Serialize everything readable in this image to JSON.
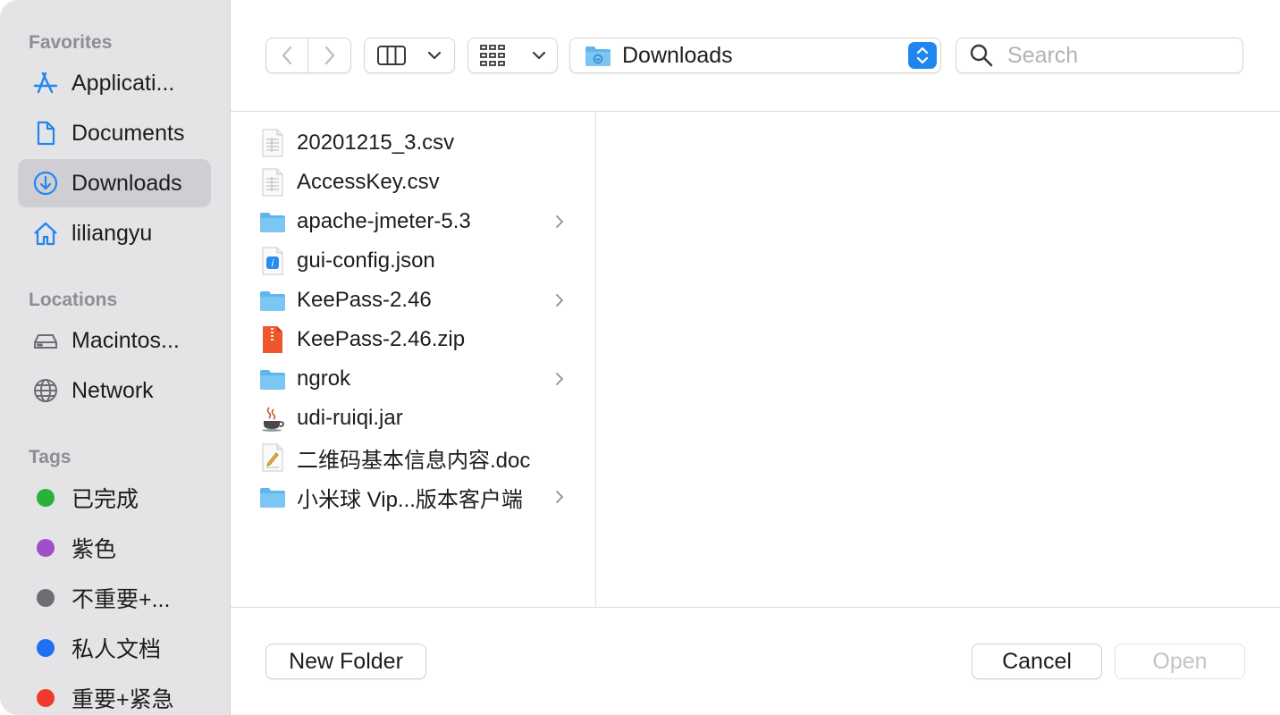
{
  "colors": {
    "accent": "#1f86f0",
    "folder": "#5fb6ef",
    "sidebar_bg": "#e4e4e6"
  },
  "sidebar": {
    "favorites_header": "Favorites",
    "favorites": [
      {
        "label": "Applicati...",
        "icon": "app-store-icon"
      },
      {
        "label": "Documents",
        "icon": "document-icon"
      },
      {
        "label": "Downloads",
        "icon": "download-circle-icon",
        "selected": true
      },
      {
        "label": "liliangyu",
        "icon": "home-icon"
      }
    ],
    "locations_header": "Locations",
    "locations": [
      {
        "label": "Macintos...",
        "icon": "hard-drive-icon"
      },
      {
        "label": "Network",
        "icon": "globe-icon"
      }
    ],
    "tags_header": "Tags",
    "tags": [
      {
        "label": "已完成",
        "color": "#28b23a"
      },
      {
        "label": "紫色",
        "color": "#a04ec9"
      },
      {
        "label": "不重要+...",
        "color": "#6e6e72"
      },
      {
        "label": "私人文档",
        "color": "#1f6ff2"
      },
      {
        "label": "重要+紧急",
        "color": "#ee3a2e"
      }
    ]
  },
  "toolbar": {
    "back_icon": "chevron-left-icon",
    "forward_icon": "chevron-right-icon",
    "view_mode_icon": "columns-view-icon",
    "group_icon": "grid-icon",
    "path_label": "Downloads",
    "search_placeholder": "Search"
  },
  "files": [
    {
      "name": "20201215_3.csv",
      "type": "csv",
      "folder": false
    },
    {
      "name": "AccessKey.csv",
      "type": "csv",
      "folder": false
    },
    {
      "name": "apache-jmeter-5.3",
      "type": "folder",
      "folder": true
    },
    {
      "name": "gui-config.json",
      "type": "json",
      "folder": false
    },
    {
      "name": "KeePass-2.46",
      "type": "folder",
      "folder": true
    },
    {
      "name": "KeePass-2.46.zip",
      "type": "zip",
      "folder": false
    },
    {
      "name": "ngrok",
      "type": "folder",
      "folder": true
    },
    {
      "name": "udi-ruiqi.jar",
      "type": "jar",
      "folder": false
    },
    {
      "name": "二维码基本信息内容.doc",
      "type": "doc",
      "folder": false
    },
    {
      "name": "小米球 Vip...版本客户端",
      "type": "folder",
      "folder": true
    }
  ],
  "footer": {
    "new_folder_label": "New Folder",
    "cancel_label": "Cancel",
    "open_label": "Open",
    "open_enabled": false
  }
}
